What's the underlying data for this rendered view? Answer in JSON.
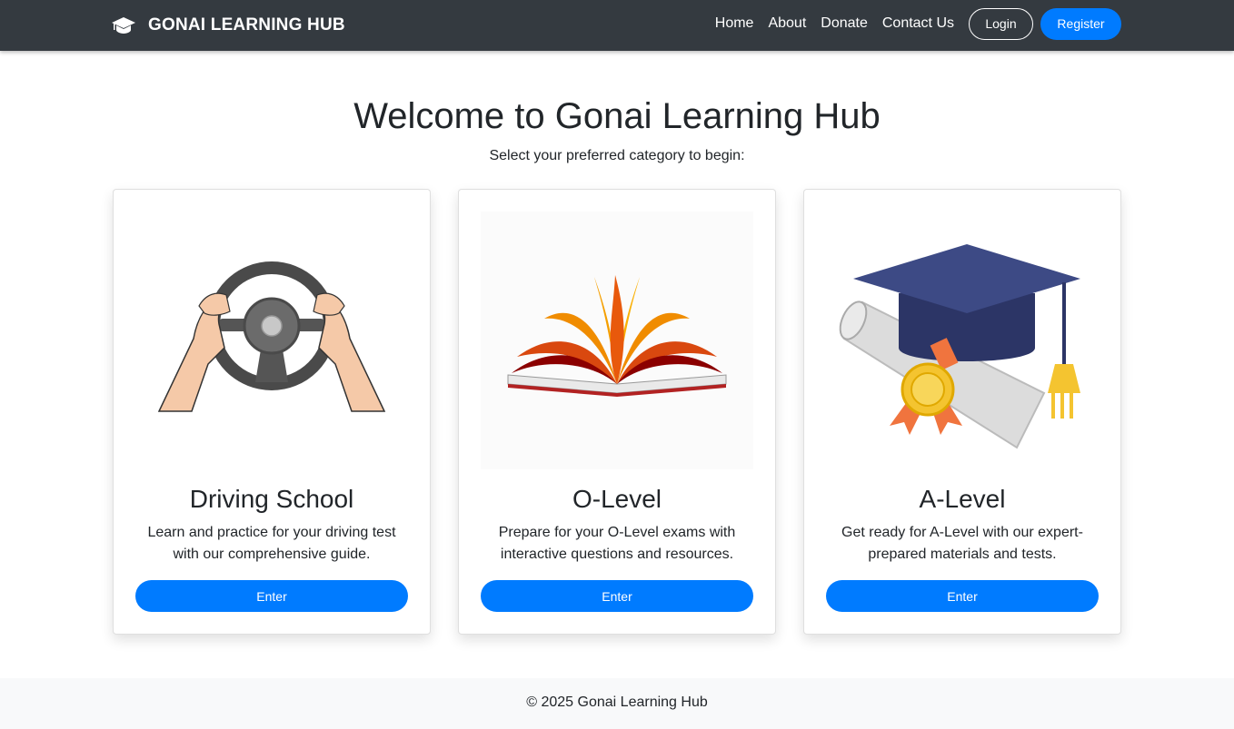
{
  "navbar": {
    "brand_icon": "graduation-cap-icon",
    "brand": "GONAI LEARNING HUB",
    "links": [
      "Home",
      "About",
      "Donate",
      "Contact Us"
    ],
    "login": "Login",
    "register": "Register"
  },
  "main": {
    "title": "Welcome to Gonai Learning Hub",
    "subtitle": "Select your preferred category to begin:"
  },
  "cards": [
    {
      "image": "steering-wheel-illustration",
      "title": "Driving School",
      "text": "Learn and practice for your driving test with our comprehensive guide.",
      "button": "Enter"
    },
    {
      "image": "open-book-illustration",
      "title": "O-Level",
      "text": "Prepare for your O-Level exams with interactive questions and resources.",
      "button": "Enter"
    },
    {
      "image": "graduation-cap-diploma-illustration",
      "title": "A-Level",
      "text": "Get ready for A-Level with our expert-prepared materials and tests.",
      "button": "Enter"
    }
  ],
  "footer": {
    "text": "© 2025 Gonai Learning Hub"
  },
  "colors": {
    "navbar_bg": "#343a40",
    "primary": "#007bff",
    "footer_bg": "#f8f9fa",
    "text": "#212529"
  }
}
